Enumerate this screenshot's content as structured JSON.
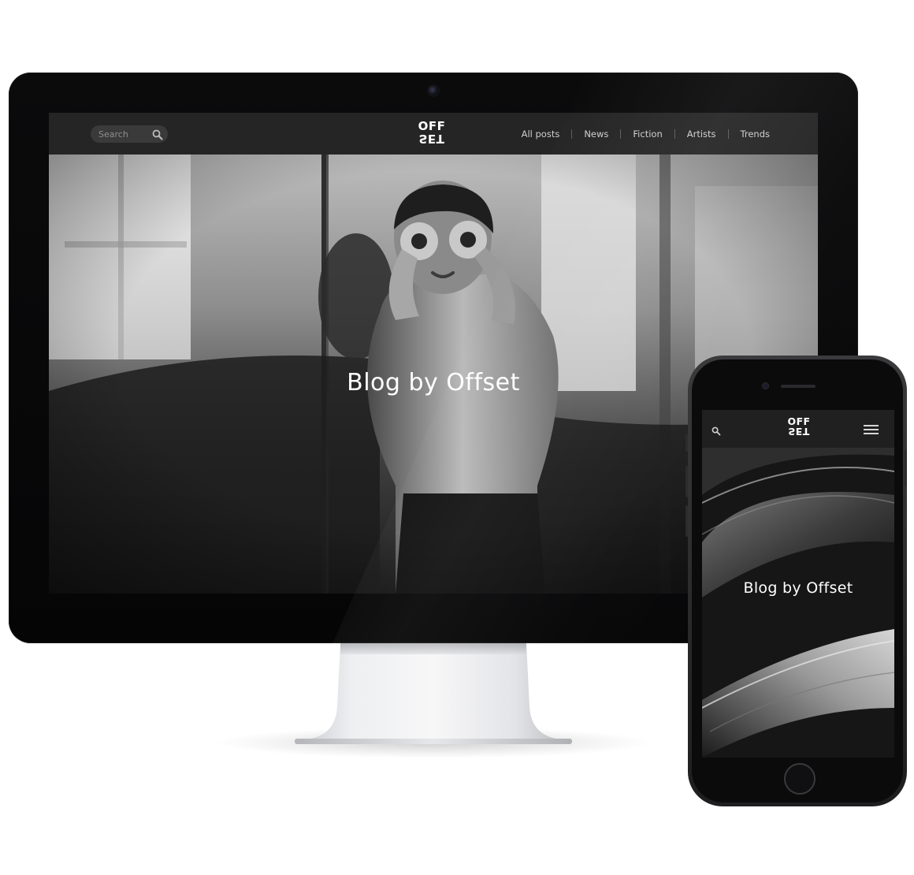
{
  "desktop": {
    "search": {
      "placeholder": "Search"
    },
    "logo": {
      "top": "OFF",
      "bottom": "SET"
    },
    "nav": {
      "items": [
        {
          "label": "All posts"
        },
        {
          "label": "News"
        },
        {
          "label": "Fiction"
        },
        {
          "label": "Artists"
        },
        {
          "label": "Trends"
        }
      ]
    },
    "hero": {
      "title": "Blog by Offset",
      "image": "black-and-white photo of a child making binoculars with hands"
    },
    "icons": {
      "search": "search-icon"
    }
  },
  "mobile": {
    "logo": {
      "top": "OFF",
      "bottom": "SET"
    },
    "hero": {
      "title": "Blog by Offset",
      "image": "black-and-white abstract texture"
    },
    "icons": {
      "search": "search-icon",
      "menu": "hamburger-menu-icon"
    }
  },
  "colors": {
    "nav_background": "#252525",
    "hero_text": "#ffffff",
    "nav_text": "#cfcfcf",
    "device_bezel": "#0b0b0c"
  }
}
